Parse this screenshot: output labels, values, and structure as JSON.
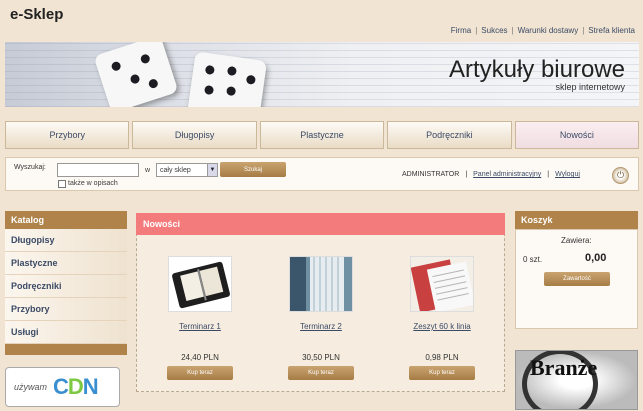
{
  "header": {
    "logo": "e-Sklep",
    "links": [
      "Firma",
      "Sukces",
      "Warunki dostawy",
      "Strefa klienta"
    ]
  },
  "banner": {
    "title": "Artykuły biurowe",
    "subtitle": "sklep internetowy"
  },
  "nav": [
    "Przybory",
    "Długopisy",
    "Plastyczne",
    "Podręczniki",
    "Nowości"
  ],
  "search": {
    "label": "Wyszukaj:",
    "value": "",
    "in_label": "w",
    "scope": "cały sklep",
    "button": "Szukaj",
    "desc_label": "także w opisach"
  },
  "admin": {
    "user": "ADMINISTRATOR",
    "panel": "Panel administracyjny",
    "logout": "Wyloguj"
  },
  "catalog": {
    "title": "Katalog",
    "items": [
      "Długopisy",
      "Plastyczne",
      "Podręczniki",
      "Przybory",
      "Usługi"
    ]
  },
  "partner": {
    "text": "używam"
  },
  "news": {
    "title": "Nowości",
    "buy_label": "Kup teraz",
    "products": [
      {
        "name": "Terminarz 1",
        "price": "24,40 PLN"
      },
      {
        "name": "Terminarz 2",
        "price": "30,50 PLN"
      },
      {
        "name": "Zeszyt 60 k linia",
        "price": "0,98 PLN"
      }
    ]
  },
  "cart": {
    "title": "Koszyk",
    "contains_label": "Zawiera:",
    "qty": "0 szt.",
    "total": "0,00",
    "button": "Zawartość"
  },
  "promo": {
    "text": "Branże"
  }
}
